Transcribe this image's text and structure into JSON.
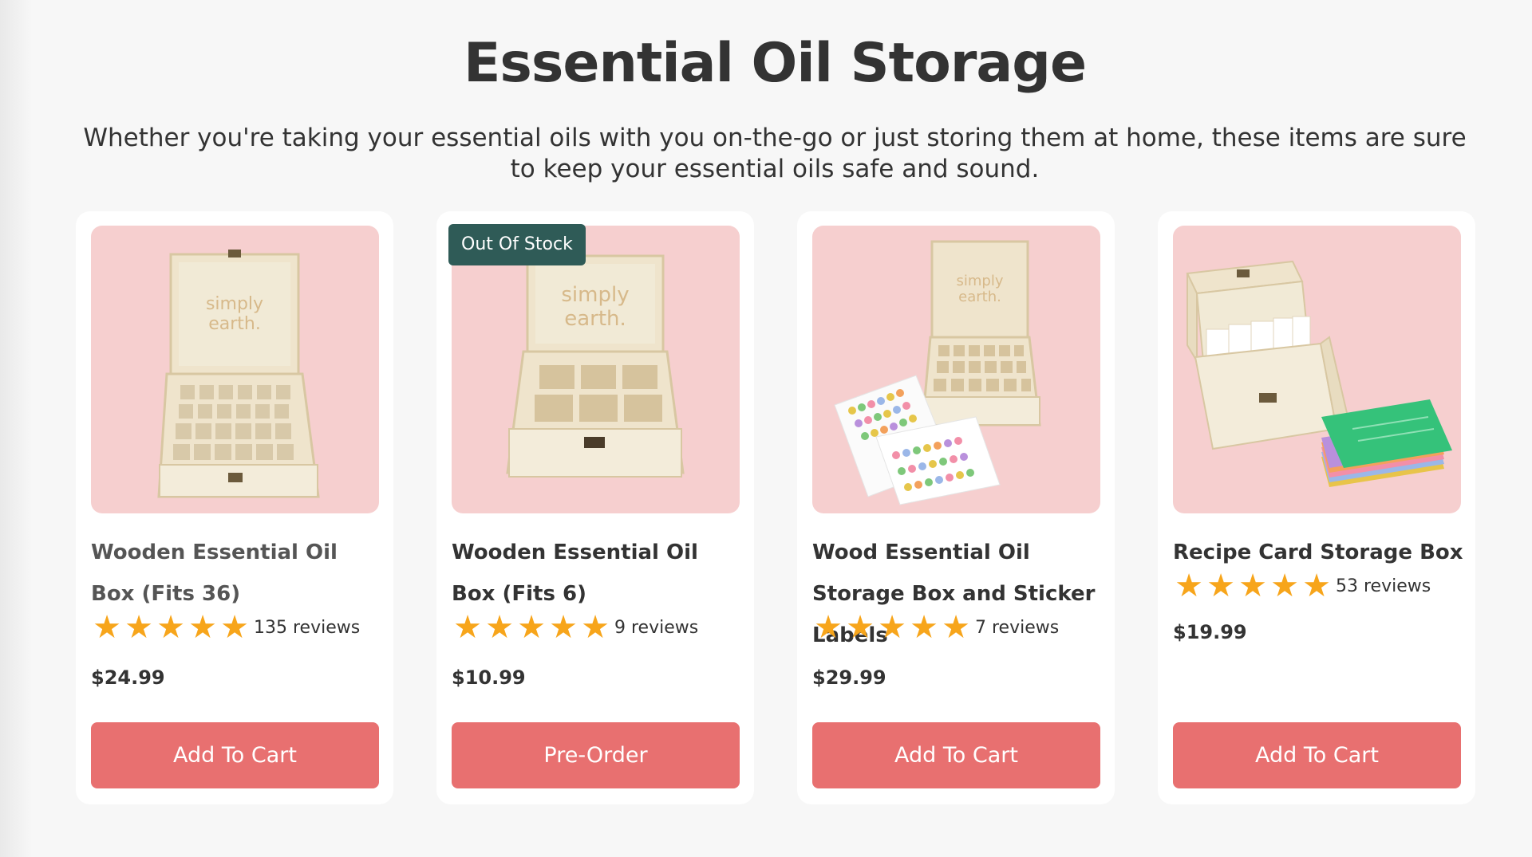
{
  "page": {
    "title": "Essential Oil Storage",
    "intro": "Whether you're taking your essential oils with you on-the-go or just storing them at home, these items are sure to keep your essential oils safe and sound."
  },
  "colors": {
    "page_background": "#f7f7f7",
    "image_background": "#f6cfcf",
    "button": "#e87070",
    "badge": "#2f5b57",
    "star": "#f7a51b"
  },
  "products": [
    {
      "name": "Wooden Essential Oil Box (Fits 36)",
      "image_icon": "wooden-box-36-slots-image",
      "rating": 5,
      "reviews": "135 reviews",
      "price": "$24.99",
      "button_label": "Add To Cart",
      "badge": ""
    },
    {
      "name": "Wooden Essential Oil Box (Fits 6)",
      "image_icon": "wooden-box-6-slots-image",
      "rating": 5,
      "reviews": "9 reviews",
      "price": "$10.99",
      "button_label": "Pre-Order",
      "badge": "Out Of Stock"
    },
    {
      "name": "Wood Essential Oil Storage Box and Sticker Labels",
      "image_icon": "wooden-box-with-sticker-sheets-image",
      "rating": 5,
      "reviews": "7 reviews",
      "price": "$29.99",
      "button_label": "Add To Cart",
      "badge": ""
    },
    {
      "name": "Recipe Card Storage Box",
      "image_icon": "recipe-card-box-image",
      "rating": 5,
      "reviews": "53 reviews",
      "price": "$19.99",
      "button_label": "Add To Cart",
      "badge": ""
    }
  ]
}
